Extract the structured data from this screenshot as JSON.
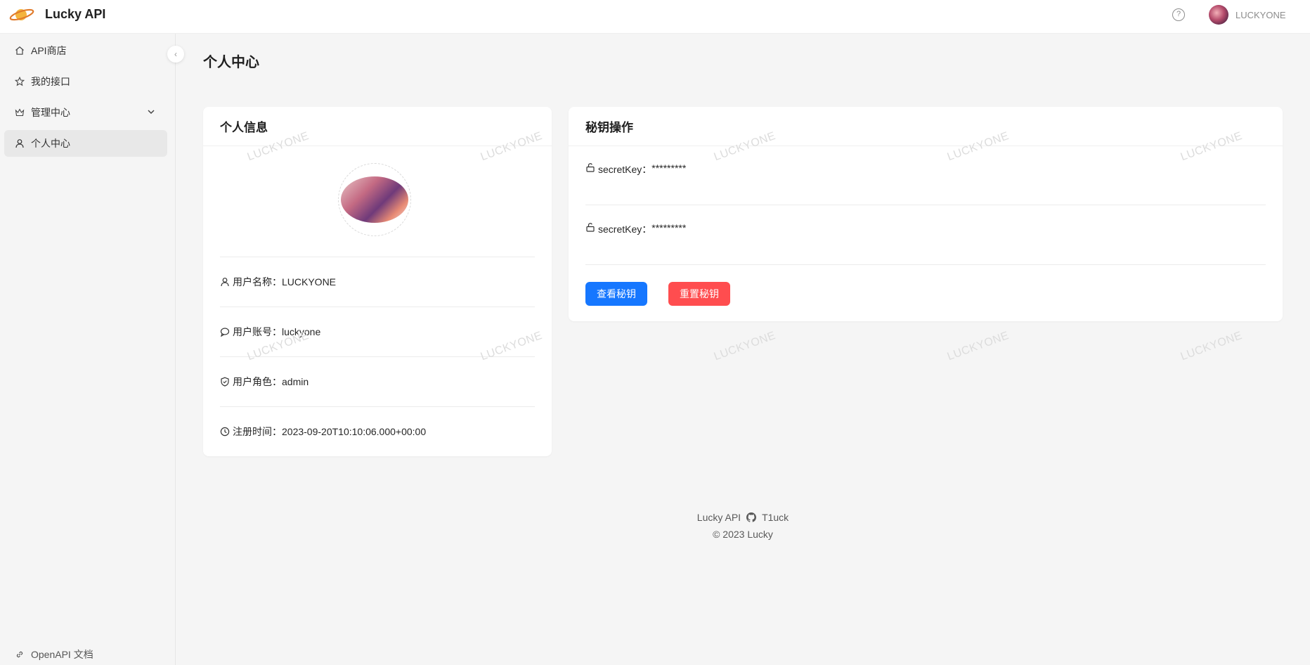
{
  "header": {
    "brand": "Lucky API",
    "user_name": "LUCKYONE",
    "help_icon": "question-circle-icon"
  },
  "sidebar": {
    "items": [
      {
        "label": "API商店",
        "icon": "home-icon"
      },
      {
        "label": "我的接口",
        "icon": "star-icon"
      },
      {
        "label": "管理中心",
        "icon": "crown-icon"
      },
      {
        "label": "个人中心",
        "icon": "user-icon"
      }
    ],
    "footer_link": "OpenAPI 文档"
  },
  "page": {
    "title": "个人中心"
  },
  "profile_card": {
    "title": "个人信息",
    "rows": [
      {
        "label": "用户名称：",
        "value": "LUCKYONE"
      },
      {
        "label": "用户账号：",
        "value": "luckyone"
      },
      {
        "label": "用户角色：",
        "value": "admin"
      },
      {
        "label": "注册时间：",
        "value": "2023-09-20T10:10:06.000+00:00"
      }
    ]
  },
  "key_card": {
    "title": "秘钥操作",
    "keys": [
      {
        "label": "secretKey：",
        "value": "*********"
      },
      {
        "label": "secretKey：",
        "value": "*********"
      }
    ],
    "view_button": "查看秘钥",
    "reset_button": "重置秘钥"
  },
  "watermark": "LUCKYONE",
  "footer": {
    "brand": "Lucky API",
    "author": "T1uck",
    "copyright": "© 2023 Lucky"
  },
  "colors": {
    "primary": "#1677ff",
    "danger": "#ff4d4f"
  }
}
